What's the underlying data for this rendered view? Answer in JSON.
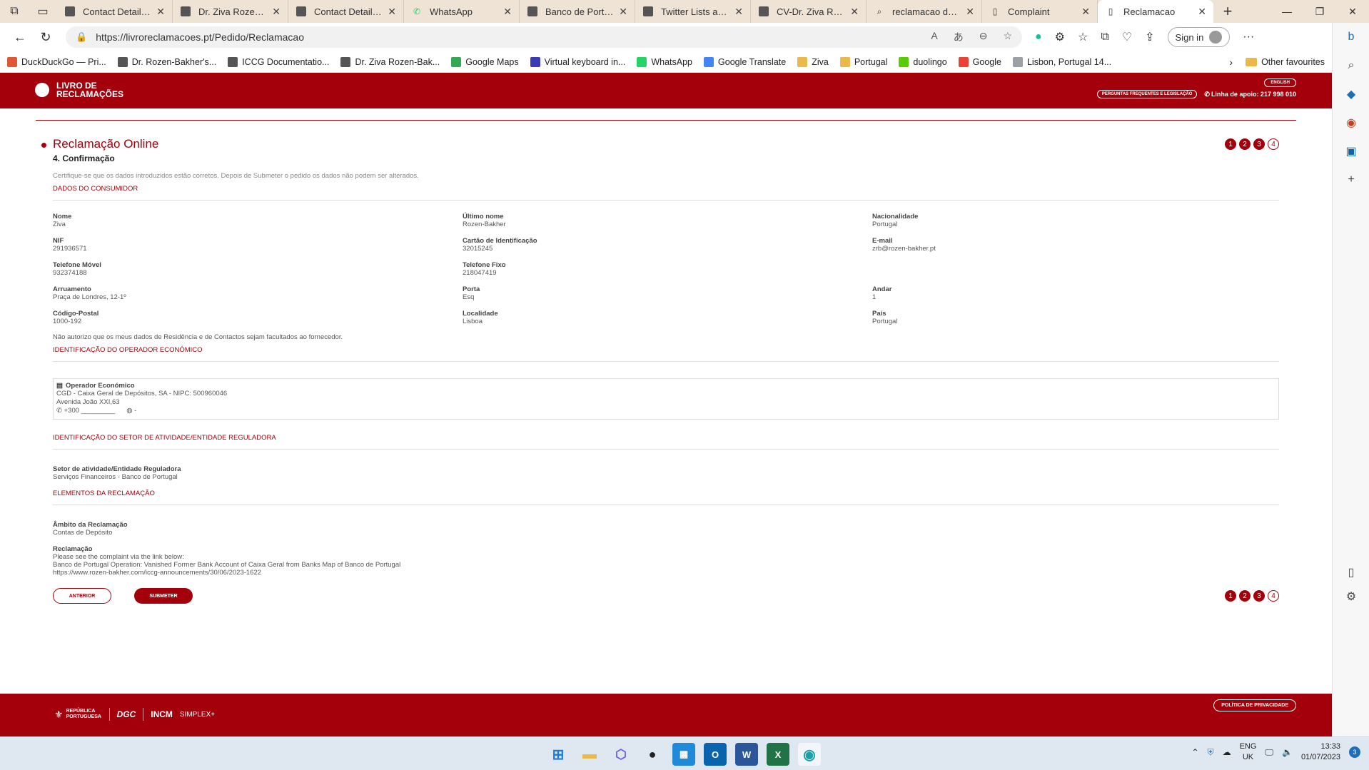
{
  "browser": {
    "tabs": [
      {
        "title": "Contact Details —",
        "icon": "cube-icon"
      },
      {
        "title": "Dr. Ziva Rozen-Bak",
        "icon": "cube-icon"
      },
      {
        "title": "Contact Details —",
        "icon": "cube-icon"
      },
      {
        "title": "WhatsApp",
        "icon": "whatsapp-icon"
      },
      {
        "title": "Banco de Portugal",
        "icon": "cube-icon"
      },
      {
        "title": "Twitter Lists and T",
        "icon": "cube-icon"
      },
      {
        "title": "CV-Dr. Ziva Rozen",
        "icon": "cube-icon"
      },
      {
        "title": "reclamacao de livr",
        "icon": "search-icon"
      },
      {
        "title": "Complaint",
        "icon": "page-icon"
      },
      {
        "title": "Reclamacao",
        "icon": "page-icon"
      }
    ],
    "url": "https://livroreclamacoes.pt/Pedido/Reclamacao",
    "signin_label": "Sign in",
    "favourites": [
      {
        "label": "DuckDuckGo — Pri...",
        "color": "#de5833"
      },
      {
        "label": "Dr. Rozen-Bakher's...",
        "color": "#555555"
      },
      {
        "label": "ICCG Documentatio...",
        "color": "#555555"
      },
      {
        "label": "Dr. Ziva Rozen-Bak...",
        "color": "#555555"
      },
      {
        "label": "Google Maps",
        "color": "#34a853"
      },
      {
        "label": "Virtual keyboard in...",
        "color": "#3b3bb3"
      },
      {
        "label": "WhatsApp",
        "color": "#25d366"
      },
      {
        "label": "Google Translate",
        "color": "#4285f4"
      },
      {
        "label": "Ziva",
        "color": "#e9b949"
      },
      {
        "label": "Portugal",
        "color": "#e9b949"
      },
      {
        "label": "duolingo",
        "color": "#58cc02"
      },
      {
        "label": "Google",
        "color": "#ea4335"
      },
      {
        "label": "Lisbon, Portugal 14...",
        "color": "#9aa0a6"
      }
    ],
    "other_favourites": "Other favourites"
  },
  "header": {
    "logo_line1": "LIVRO DE",
    "logo_line2": "RECLAMAÇÕES",
    "lang_button": "ENGLISH",
    "faq_button": "PERGUNTAS FREQUENTES E LEGISLAÇÃO",
    "support_line": "Linha de apoio: 217 998 010"
  },
  "form": {
    "title": "Reclamação Online",
    "step_title": "4. Confirmação",
    "steps": [
      "1",
      "2",
      "3",
      "4"
    ],
    "note": "Certifique-se que os dados introduzidos estão corretos. Depois de Submeter o pedido os dados não podem ser alterados.",
    "consumer_section": "DADOS DO CONSUMIDOR",
    "consumer_fields": [
      {
        "label": "Nome",
        "value": "Ziva"
      },
      {
        "label": "Último nome",
        "value": "Rozen-Bakher"
      },
      {
        "label": "Nacionalidade",
        "value": "Portugal"
      },
      {
        "label": "NIF",
        "value": "291936571"
      },
      {
        "label": "Cartão de Identificação",
        "value": "32015245"
      },
      {
        "label": "E-mail",
        "value": "zrb@rozen-bakher.pt"
      },
      {
        "label": "Telefone Móvel",
        "value": "932374188"
      },
      {
        "label": "Telefone Fixo",
        "value": "218047419"
      },
      {
        "label": "",
        "value": ""
      },
      {
        "label": "Arruamento",
        "value": "Praça de Londres, 12-1º"
      },
      {
        "label": "Porta",
        "value": "Esq"
      },
      {
        "label": "Andar",
        "value": "1"
      },
      {
        "label": "Código-Postal",
        "value": "1000-192"
      },
      {
        "label": "Localidade",
        "value": "Lisboa"
      },
      {
        "label": "País",
        "value": "Portugal"
      }
    ],
    "consent": "Não autorizo que os meus dados de Residência e de Contactos sejam facultados ao fornecedor.",
    "operator_section": "IDENTIFICAÇÃO DO OPERADOR ECONÓMICO",
    "operator": {
      "label": "Operador Económico",
      "name": "CGD - Caixa Geral de Depósitos, SA - NIPC: 500960046",
      "address": "Avenida João XXI,63",
      "phone": "+300 _________",
      "web": "-"
    },
    "sector_section": "IDENTIFICAÇÃO DO SETOR DE ATIVIDADE/ENTIDADE REGULADORA",
    "sector": {
      "label": "Setor de atividade/Entidade Reguladora",
      "value": "Serviços Financeiros - Banco de Portugal"
    },
    "elements_section": "ELEMENTOS DA RECLAMAÇÃO",
    "scope": {
      "label": "Âmbito da Reclamação",
      "value": "Contas de Depósito"
    },
    "complaint": {
      "label": "Reclamação",
      "lines": [
        "Please see the complaint via the link below:",
        "Banco de Portugal Operation: Vanished Former Bank Account of Caixa Geral from Banks Map of Banco de Portugal",
        "https://www.rozen-bakher.com/iccg-announcements/30/06/2023-1622"
      ]
    },
    "prev_button": "ANTERIOR",
    "submit_button": "SUBMETER"
  },
  "footer": {
    "republic": "REPÚBLICA PORTUGUESA",
    "dgc": "DGC",
    "incm": "INCM",
    "simplex": "SIMPLEX+",
    "privacy_button": "POLÍTICA DE PRIVACIDADE"
  },
  "taskbar": {
    "lang_line1": "ENG",
    "lang_line2": "UK",
    "time": "13:33",
    "date": "01/07/2023",
    "notifications": "3"
  },
  "colors": {
    "brand": "#a3000b"
  }
}
